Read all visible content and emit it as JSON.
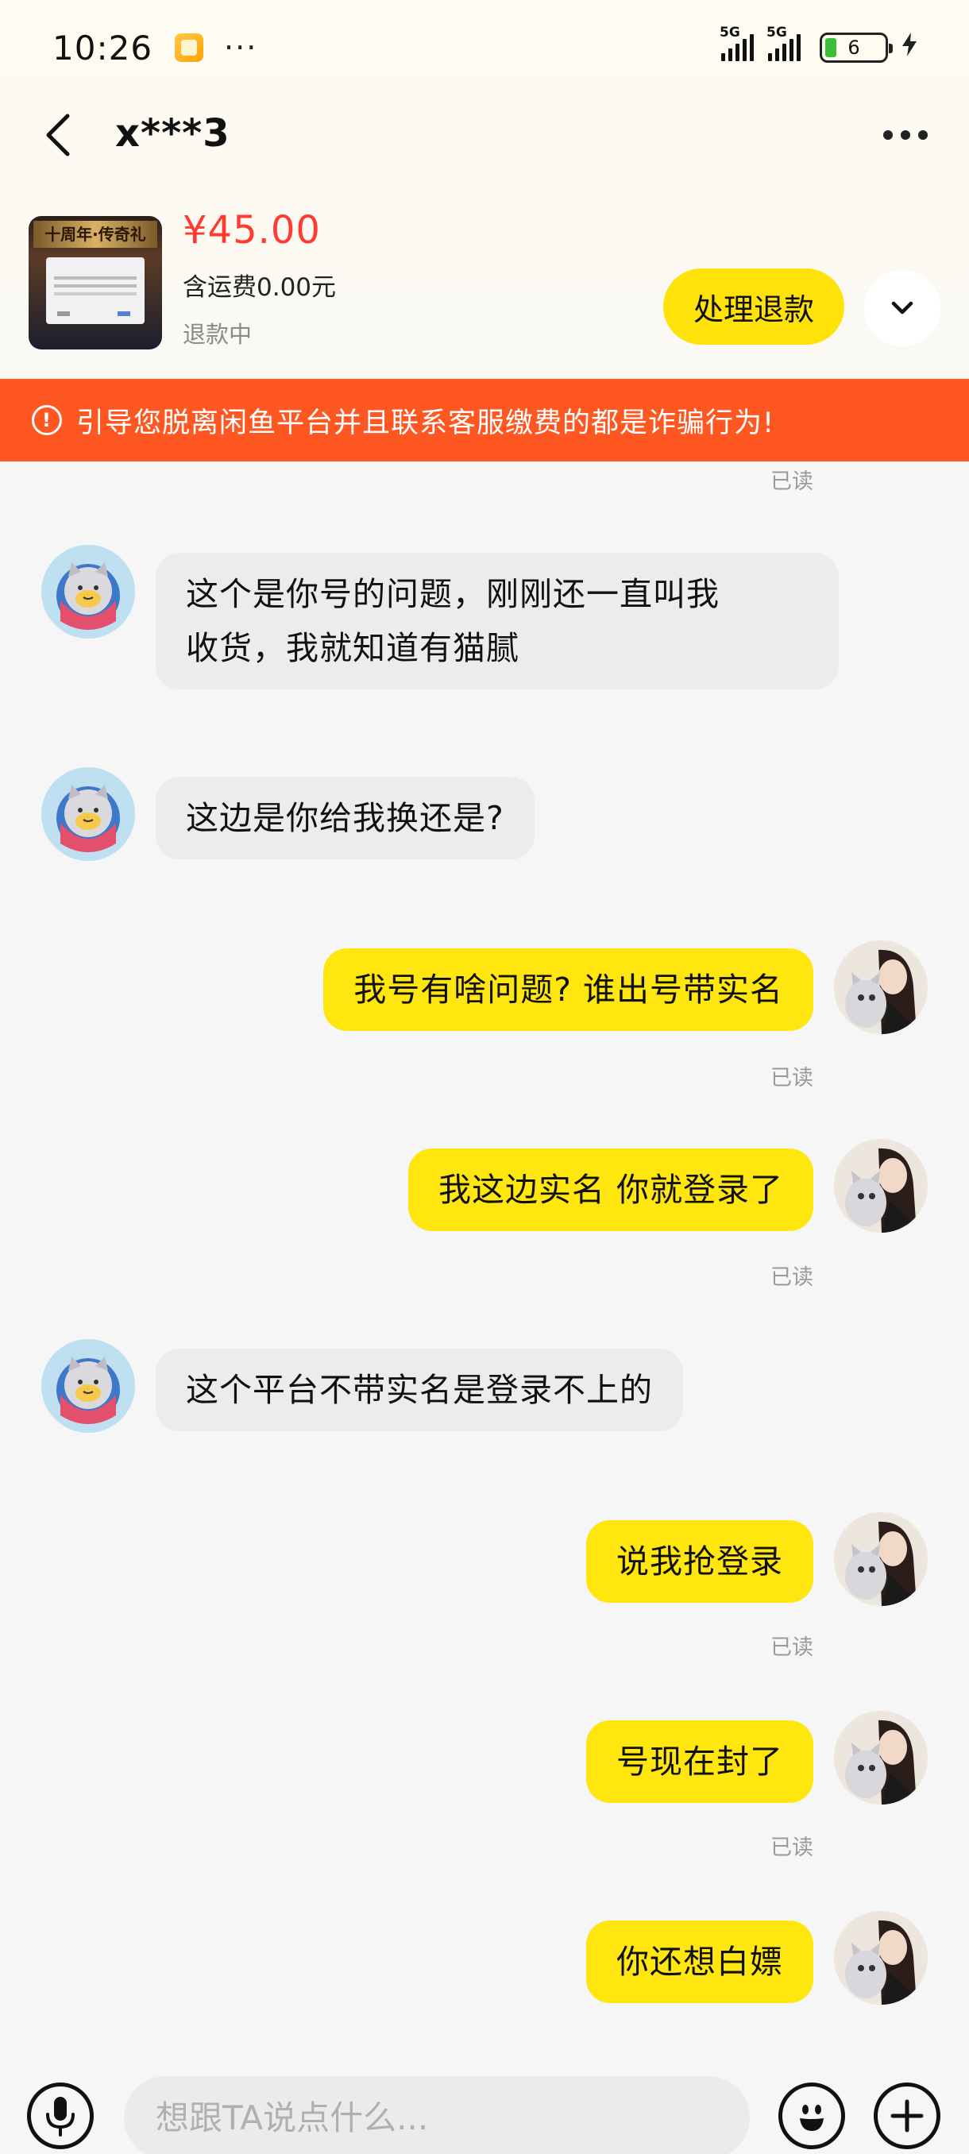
{
  "status_bar": {
    "time": "10:26",
    "dots": "···",
    "signal1_label": "5G",
    "signal2_label": "5G",
    "battery": "6"
  },
  "header": {
    "title": "x***3"
  },
  "product": {
    "price": "¥45.00",
    "shipping": "含运费0.00元",
    "status": "退款中",
    "thumb_title": "十周年·传奇礼",
    "refund_button": "处理退款"
  },
  "warning": {
    "icon": "!",
    "text": "引导您脱离闲鱼平台并且联系客服缴费的都是诈骗行为!"
  },
  "messages": {
    "top_read": "已读",
    "m1": {
      "text_line1": "这个是你号的问题，刚刚还一直叫我",
      "text_line2": "收货，我就知道有猫腻"
    },
    "m2": {
      "text": "这边是你给我换还是?"
    },
    "m3": {
      "text": "我号有啥问题? 谁出号带实名",
      "read": "已读"
    },
    "m4": {
      "text": "我这边实名 你就登录了",
      "read": "已读"
    },
    "m5": {
      "text": "这个平台不带实名是登录不上的"
    },
    "m6": {
      "text": "说我抢登录",
      "read": "已读"
    },
    "m7": {
      "text": "号现在封了",
      "read": "已读"
    },
    "m8": {
      "text": "你还想白嫖"
    }
  },
  "input": {
    "placeholder": "想跟TA说点什么..."
  },
  "colors": {
    "accent_yellow": "#ffe60f",
    "price_red": "#ff3b30",
    "warning_orange": "#ff5722"
  },
  "icons": {
    "back": "chevron-left-icon",
    "more": "more-dots-icon",
    "expand": "chevron-down-icon",
    "mic": "microphone-icon",
    "emoji": "emoji-icon",
    "plus": "plus-icon"
  }
}
